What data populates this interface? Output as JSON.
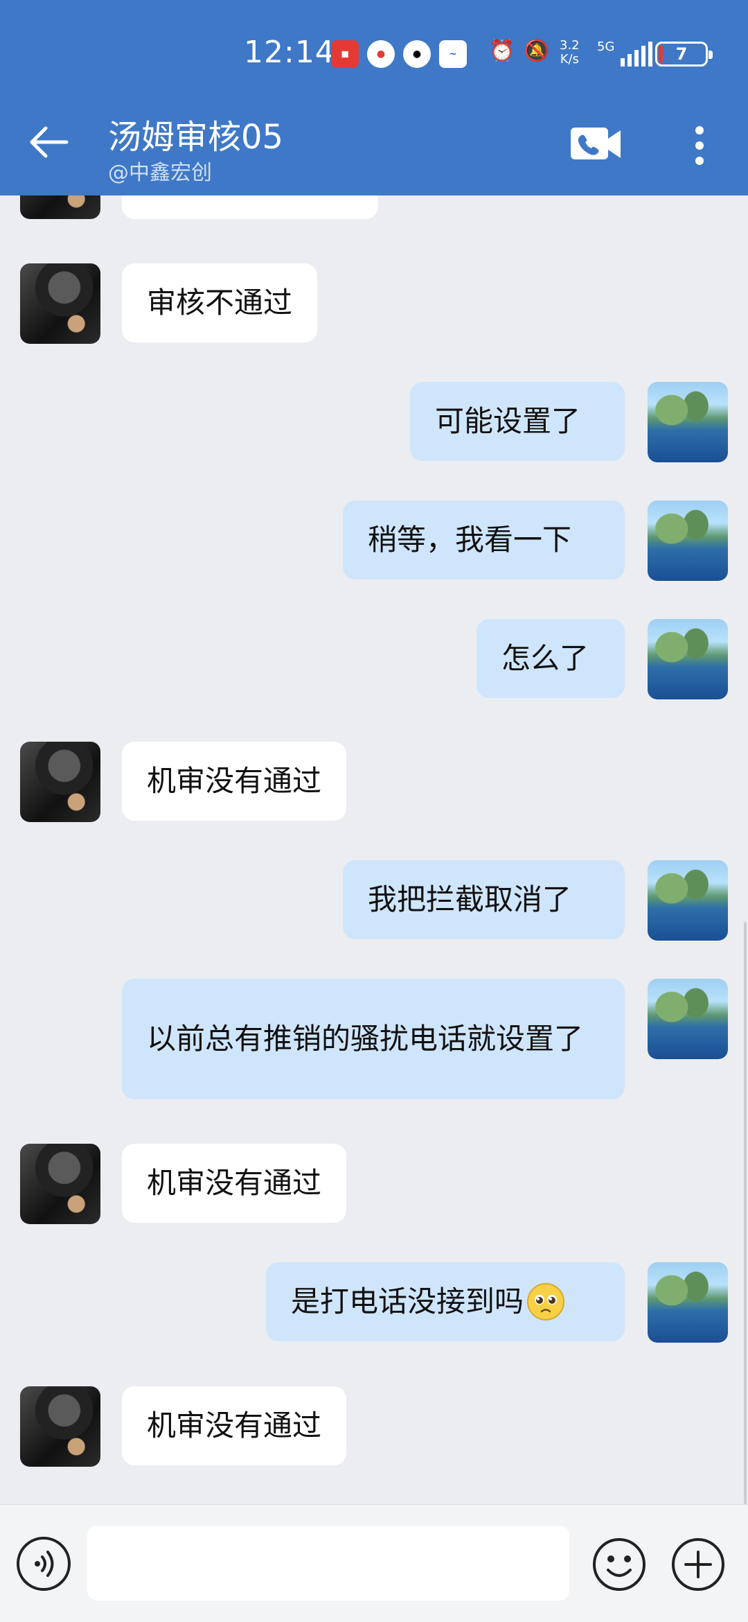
{
  "status_bar": {
    "time": "12:14",
    "net_speed_value": "3.2",
    "net_speed_unit": "K/s",
    "network": "5G",
    "battery": "7"
  },
  "header": {
    "title": "汤姆审核05",
    "subtitle": "@中鑫宏创"
  },
  "messages": [
    {
      "side": "in",
      "text": "审核不通过"
    },
    {
      "side": "out",
      "text": "可能设置了"
    },
    {
      "side": "out",
      "text": "稍等，我看一下"
    },
    {
      "side": "out",
      "text": "怎么了"
    },
    {
      "side": "in",
      "text": "机审没有通过"
    },
    {
      "side": "out",
      "text": "我把拦截取消了"
    },
    {
      "side": "out",
      "text": "以前总有推销的骚扰电话就设置了"
    },
    {
      "side": "in",
      "text": "机审没有通过"
    },
    {
      "side": "out",
      "text": "是打电话没接到吗"
    },
    {
      "side": "in",
      "text": "机审没有通过"
    }
  ],
  "input": {
    "value": ""
  }
}
